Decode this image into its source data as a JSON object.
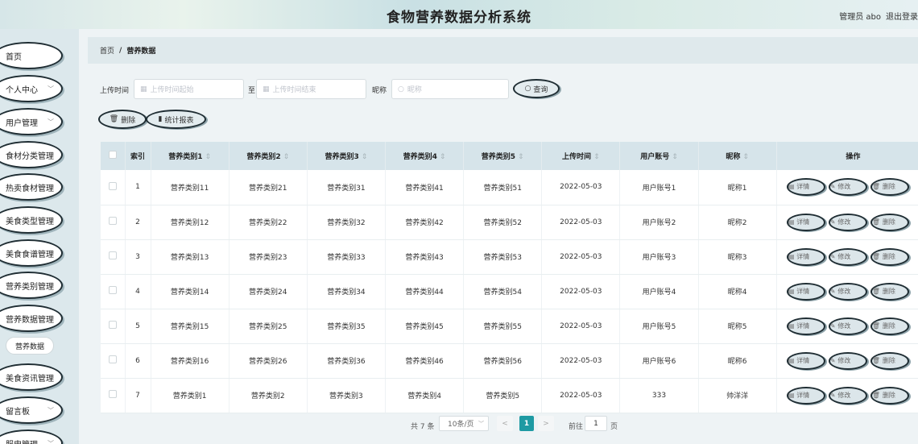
{
  "header": {
    "title": "食物营养数据分析系统",
    "user": "管理员 abo",
    "logout": "退出登录"
  },
  "sidebar": {
    "items": [
      {
        "label": "首页",
        "chevron": false
      },
      {
        "label": "个人中心",
        "chevron": true
      },
      {
        "label": "用户管理",
        "chevron": true
      },
      {
        "label": "食材分类管理",
        "chevron": false
      },
      {
        "label": "热卖食材管理",
        "chevron": false
      },
      {
        "label": "美食类型管理",
        "chevron": false
      },
      {
        "label": "美食食谱管理",
        "chevron": false
      },
      {
        "label": "营养类别管理",
        "chevron": false
      },
      {
        "label": "营养数据管理",
        "chevron": false
      },
      {
        "label": "美食资讯管理",
        "chevron": false
      },
      {
        "label": "留言板",
        "chevron": true
      },
      {
        "label": "服申管理",
        "chevron": true
      }
    ],
    "subitem": "营养数据"
  },
  "breadcrumb": {
    "home": "首页",
    "separator": "/",
    "current": "营养数据"
  },
  "search": {
    "upload_time_label": "上传时间",
    "start_placeholder": "上传时间起始",
    "to_label": "至",
    "end_placeholder": "上传时间结束",
    "nickname_label": "昵称",
    "nickname_placeholder": "昵称",
    "query_button": "查询"
  },
  "actions": {
    "delete_button": "删除",
    "report_button": "统计报表"
  },
  "table": {
    "headers": {
      "index": "索引",
      "cat1": "营养类别1",
      "cat2": "营养类别2",
      "cat3": "营养类别3",
      "cat4": "营养类别4",
      "cat5": "营养类别5",
      "upload_time": "上传时间",
      "account": "用户账号",
      "nickname": "昵称",
      "operation": "操作"
    },
    "row_actions": {
      "detail": "详情",
      "edit": "修改",
      "delete": "删除"
    },
    "rows": [
      {
        "index": "1",
        "cat1": "营养类别11",
        "cat2": "营养类别21",
        "cat3": "营养类别31",
        "cat4": "营养类别41",
        "cat5": "营养类别51",
        "upload_time": "2022-05-03",
        "account": "用户账号1",
        "nickname": "昵称1"
      },
      {
        "index": "2",
        "cat1": "营养类别12",
        "cat2": "营养类别22",
        "cat3": "营养类别32",
        "cat4": "营养类别42",
        "cat5": "营养类别52",
        "upload_time": "2022-05-03",
        "account": "用户账号2",
        "nickname": "昵称2"
      },
      {
        "index": "3",
        "cat1": "营养类别13",
        "cat2": "营养类别23",
        "cat3": "营养类别33",
        "cat4": "营养类别43",
        "cat5": "营养类别53",
        "upload_time": "2022-05-03",
        "account": "用户账号3",
        "nickname": "昵称3"
      },
      {
        "index": "4",
        "cat1": "营养类别14",
        "cat2": "营养类别24",
        "cat3": "营养类别34",
        "cat4": "营养类别44",
        "cat5": "营养类别54",
        "upload_time": "2022-05-03",
        "account": "用户账号4",
        "nickname": "昵称4"
      },
      {
        "index": "5",
        "cat1": "营养类别15",
        "cat2": "营养类别25",
        "cat3": "营养类别35",
        "cat4": "营养类别45",
        "cat5": "营养类别55",
        "upload_time": "2022-05-03",
        "account": "用户账号5",
        "nickname": "昵称5"
      },
      {
        "index": "6",
        "cat1": "营养类别16",
        "cat2": "营养类别26",
        "cat3": "营养类别36",
        "cat4": "营养类别46",
        "cat5": "营养类别56",
        "upload_time": "2022-05-03",
        "account": "用户账号6",
        "nickname": "昵称6"
      },
      {
        "index": "7",
        "cat1": "营养类别1",
        "cat2": "营养类别2",
        "cat3": "营养类别3",
        "cat4": "营养类别4",
        "cat5": "营养类别5",
        "upload_time": "2022-05-03",
        "account": "333",
        "nickname": "帅洋洋"
      }
    ]
  },
  "pagination": {
    "total": "共 7 条",
    "page_size": "10条/页",
    "prev": "<",
    "current_page": "1",
    "next": ">",
    "goto_label": "前往",
    "goto_value": "1",
    "page_unit": "页"
  },
  "colors": {
    "accent": "#1e9aa3",
    "table_header": "#d6e4ea",
    "sidebar_bg": "#dce8ec"
  }
}
